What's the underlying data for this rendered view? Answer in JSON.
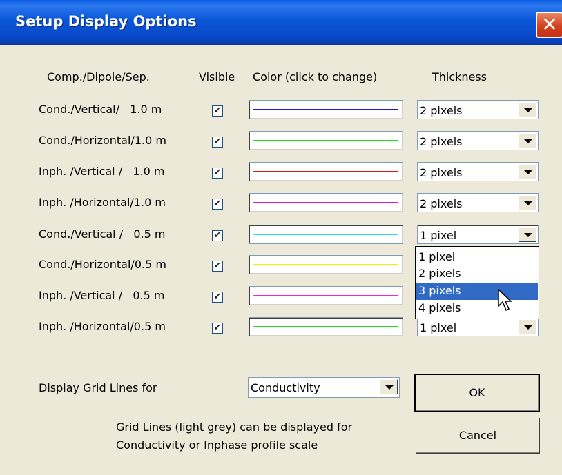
{
  "window": {
    "title": "Setup Display Options",
    "close_icon": "close-icon"
  },
  "headers": {
    "comp": "Comp./Dipole/Sep.",
    "visible": "Visible",
    "color": "Color (click to change)",
    "thickness": "Thickness"
  },
  "rows": [
    {
      "label": "Cond./Vertical/   1.0 m",
      "visible": true,
      "color": "#1a1ad0",
      "thickness": "2 pixels"
    },
    {
      "label": "Cond./Horizontal/1.0 m",
      "visible": true,
      "color": "#14e614",
      "thickness": "2 pixels"
    },
    {
      "label": "Inph. /Vertical /   1.0 m",
      "visible": true,
      "color": "#e01414",
      "thickness": "2 pixels"
    },
    {
      "label": "Inph. /Horizontal/1.0 m",
      "visible": true,
      "color": "#e014e0",
      "thickness": "2 pixels"
    },
    {
      "label": "Cond./Vertical /   0.5 m",
      "visible": true,
      "color": "#1ee0f0",
      "thickness": "1 pixel"
    },
    {
      "label": "Cond./Horizontal/0.5 m",
      "visible": true,
      "color": "#f0f000",
      "thickness": ""
    },
    {
      "label": "Inph. /Vertical /   0.5 m",
      "visible": true,
      "color": "#f020f0",
      "thickness": ""
    },
    {
      "label": "Inph. /Horizontal/0.5 m",
      "visible": true,
      "color": "#20e020",
      "thickness": "1 pixel"
    }
  ],
  "dropdown": {
    "options": [
      "1 pixel",
      "2 pixels",
      "3 pixels",
      "4 pixels"
    ],
    "highlighted": "3 pixels"
  },
  "grid": {
    "label": "Display Grid Lines for",
    "value": "Conductivity",
    "note_line1": "Grid Lines (light grey) can be displayed for",
    "note_line2": "Conductivity or Inphase profile scale"
  },
  "buttons": {
    "ok": "OK",
    "cancel": "Cancel"
  }
}
